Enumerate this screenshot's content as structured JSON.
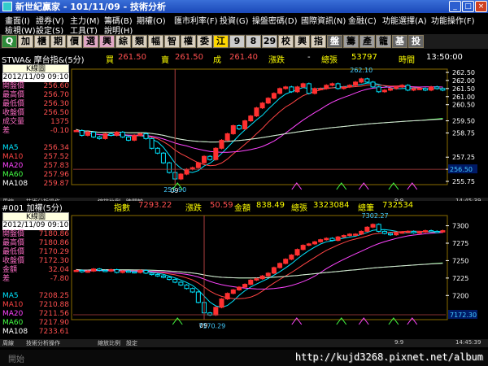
{
  "window": {
    "title": "新世紀贏家 - 101/11/09 - 技術分析"
  },
  "menu": {
    "row1": [
      "畫面(I)",
      "證券(V)",
      "主力(M)",
      "籌碼(B)",
      "期權(O)",
      "匯市利率(F)",
      "投資(G)",
      "操盤密碼(D)",
      "國際資訊(N)",
      "金融(C)",
      "功能選擇(A)",
      "功能操作(F)"
    ],
    "row2": [
      "檢視(W)",
      "設定(S)",
      "工具(T)",
      "說明(H)"
    ]
  },
  "toolbar": {
    "buttons": [
      "Q",
      "加",
      "櫃",
      "期",
      "價",
      "選",
      "興",
      "綜",
      "類",
      "幅",
      "智",
      "權",
      "委",
      "江",
      "9",
      "8",
      "29",
      "校",
      "興",
      "指",
      "盤",
      "籌",
      "產",
      "籠",
      "基",
      "投"
    ]
  },
  "panel1": {
    "header": {
      "symbol": "STWA& 摩台指&(5分)",
      "buy_label": "買",
      "buy": "261.50",
      "sell_label": "賣",
      "sell": "261.50",
      "deal_label": "成",
      "deal": "261.40",
      "chg_label": "漲跌",
      "chg": "-",
      "vol_label": "總張",
      "vol": "53797",
      "time_label": "時間",
      "time": "13:50:00"
    },
    "info": {
      "chart_label": "K線圖",
      "date": "2012/11/09 09:10",
      "rows": [
        [
          "開盤價",
          "256.60"
        ],
        [
          "最高價",
          "256.70"
        ],
        [
          "最低價",
          "256.30"
        ],
        [
          "收盤價",
          "256.50"
        ],
        [
          "成交量",
          "1375"
        ],
        [
          "差",
          "-0.10"
        ]
      ],
      "ma": [
        [
          "MA5",
          "256.34",
          "#00e5ff"
        ],
        [
          "MA10",
          "257.52",
          "#ff4444"
        ],
        [
          "MA20",
          "257.83",
          "#ff44ff"
        ],
        [
          "MA60",
          "257.96",
          "#44ff44"
        ],
        [
          "MA108",
          "259.87",
          "#ffffff"
        ]
      ]
    },
    "axis": [
      "262.50",
      "262.00",
      "261.50",
      "261.00",
      "260.50",
      "259.50",
      "258.75",
      "257.25",
      "256.50",
      "255.75"
    ],
    "price_box": "256.50",
    "high_label": "262.10",
    "low_label": "255.90",
    "xlabel": "09",
    "status": [
      "周線",
      "技術分析操作",
      "縮放比例",
      "時間軸",
      "9:9",
      "14:45:39"
    ]
  },
  "panel2": {
    "header": {
      "symbol": "#001 加權(5分)",
      "idx_label": "指數",
      "idx": "7293.22",
      "chg_label": "漲跌",
      "chg": "50.59",
      "amt_label": "金額",
      "amt": "838.49",
      "vol_label": "總張",
      "vol": "3323084",
      "cnt_label": "總筆",
      "cnt": "732534"
    },
    "info": {
      "chart_label": "K線圖",
      "date": "2012/11/09 09:10",
      "rows": [
        [
          "開盤價",
          "7180.86"
        ],
        [
          "最高價",
          "7180.86"
        ],
        [
          "最低價",
          "7170.29"
        ],
        [
          "收盤價",
          "7172.30"
        ],
        [
          "金額",
          "32.04"
        ],
        [
          "差",
          "-7.80"
        ]
      ],
      "ma": [
        [
          "MA5",
          "7208.25",
          "#00e5ff"
        ],
        [
          "MA10",
          "7210.88",
          "#ff4444"
        ],
        [
          "MA20",
          "7211.56",
          "#ff44ff"
        ],
        [
          "MA60",
          "7217.90",
          "#44ff44"
        ],
        [
          "MA108",
          "7233.61",
          "#ffffff"
        ]
      ]
    },
    "axis": [
      "7300",
      "7275",
      "7250",
      "7225",
      "7200"
    ],
    "price_box": "7172.30",
    "high_label": "7302.27",
    "low_label": "7170.29",
    "xlabel": "09",
    "status": [
      "周線",
      "技術分析操作",
      "縮放比例",
      "設定",
      "9:9",
      "14:45:39"
    ]
  },
  "footer": {
    "watermark": "http://kujd3268.pixnet.net/album",
    "start": "開始"
  },
  "colors": {
    "up": "#ff3030",
    "down": "#00e5ff",
    "axis": "#ffffff",
    "frame": "#c8a000"
  },
  "chart_data": [
    {
      "type": "candlestick",
      "name": "摩台指&(5分)",
      "ylim": [
        255.75,
        262.5
      ],
      "xlabel": "09",
      "close": [
        258.9,
        258.6,
        258.8,
        258.5,
        258.4,
        258.7,
        258.6,
        258.8,
        258.5,
        258.3,
        258.6,
        258.7,
        258.4,
        257.8,
        257.5,
        256.9,
        256.3,
        255.9,
        256.2,
        256.5,
        256.6,
        256.9,
        257.3,
        257.1,
        257.8,
        258.3,
        258.7,
        259.2,
        259.0,
        259.5,
        259.8,
        260.3,
        260.6,
        260.9,
        261.2,
        261.5,
        261.6,
        261.3,
        261.6,
        261.8,
        261.2,
        261.5,
        261.5,
        261.7,
        261.8,
        261.5,
        261.6,
        261.7,
        261.9,
        262.1,
        261.9,
        261.6,
        261.3,
        261.4,
        261.5,
        261.6,
        261.7,
        261.4,
        261.5,
        261.5,
        261.4,
        261.6,
        261.5,
        261.4
      ]
    },
    {
      "type": "candlestick",
      "name": "加權(5分)",
      "ylim": [
        7170,
        7310
      ],
      "xlabel": "09",
      "close": [
        7236,
        7234,
        7235,
        7238,
        7236,
        7235,
        7237,
        7233,
        7235,
        7234,
        7233,
        7236,
        7232,
        7230,
        7228,
        7226,
        7223,
        7219,
        7215,
        7210,
        7205,
        7190,
        7175,
        7172,
        7183,
        7195,
        7203,
        7208,
        7212,
        7216,
        7222,
        7224,
        7228,
        7232,
        7240,
        7246,
        7252,
        7258,
        7266,
        7272,
        7274,
        7277,
        7280,
        7282,
        7279,
        7284,
        7286,
        7288,
        7288,
        7292,
        7298,
        7302,
        7292,
        7289,
        7287,
        7290,
        7291,
        7292,
        7290,
        7291,
        7293,
        7292,
        7291,
        7293
      ]
    }
  ]
}
